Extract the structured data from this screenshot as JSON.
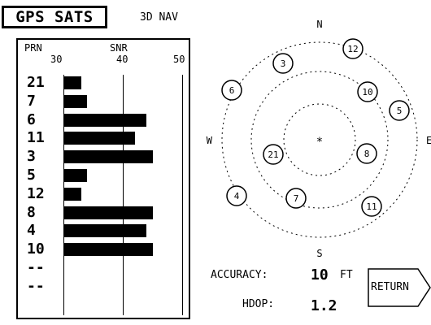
{
  "title": "GPS SATS",
  "nav_mode": "3D NAV",
  "snr_panel": {
    "prn_header": "PRN",
    "snr_header": "SNR",
    "scale_labels": [
      "30",
      "40",
      "50"
    ],
    "satellites": [
      {
        "prn": "21",
        "snr": 33
      },
      {
        "prn": "7",
        "snr": 34
      },
      {
        "prn": "6",
        "snr": 44
      },
      {
        "prn": "11",
        "snr": 42
      },
      {
        "prn": "3",
        "snr": 45
      },
      {
        "prn": "5",
        "snr": 34
      },
      {
        "prn": "12",
        "snr": 33
      },
      {
        "prn": "8",
        "snr": 45
      },
      {
        "prn": "4",
        "snr": 44
      },
      {
        "prn": "10",
        "snr": 45
      },
      {
        "prn": "--",
        "snr": null
      },
      {
        "prn": "--",
        "snr": null
      }
    ]
  },
  "sky_view": {
    "north": "N",
    "south": "S",
    "east": "E",
    "west": "W",
    "center_marker": "*",
    "satellites": [
      {
        "prn": "12",
        "ring": "outer"
      },
      {
        "prn": "3",
        "ring": "middle"
      },
      {
        "prn": "6",
        "ring": "outer"
      },
      {
        "prn": "10",
        "ring": "middle"
      },
      {
        "prn": "5",
        "ring": "outer"
      },
      {
        "prn": "21",
        "ring": "inner"
      },
      {
        "prn": "8",
        "ring": "inner"
      },
      {
        "prn": "7",
        "ring": "middle"
      },
      {
        "prn": "4",
        "ring": "outer"
      },
      {
        "prn": "11",
        "ring": "middle"
      }
    ]
  },
  "status": {
    "accuracy_label": "ACCURACY:",
    "accuracy_value": "10",
    "accuracy_unit": "FT",
    "hdop_label": "HDOP:",
    "hdop_value": "1.2"
  },
  "return_button": {
    "label": "RETURN"
  }
}
